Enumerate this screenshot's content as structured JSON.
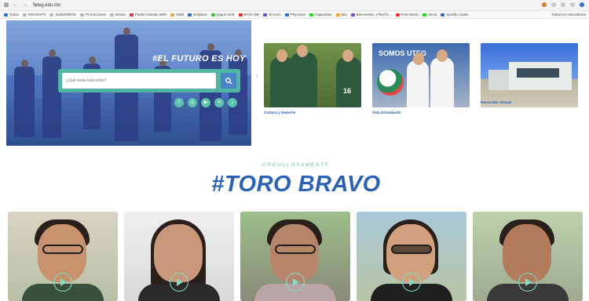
{
  "browser": {
    "url": "uteg.edu.mx",
    "bookmarks": [
      {
        "label": "Todas"
      },
      {
        "label": "MOOVAPS"
      },
      {
        "label": "SUBURBIOS"
      },
      {
        "label": "Promociones"
      },
      {
        "label": "Becas"
      },
      {
        "label": "Portal Cuentas Web"
      },
      {
        "label": "UNM"
      },
      {
        "label": "Empleos"
      },
      {
        "label": "pagos SGE"
      },
      {
        "label": "BAN LME"
      },
      {
        "label": "El Leon"
      },
      {
        "label": "Physician"
      },
      {
        "label": "Capacitate"
      },
      {
        "label": "Mia"
      },
      {
        "label": "Bienvenido, ¡Fleet le..."
      },
      {
        "label": "Free Music"
      },
      {
        "label": "Ateca"
      },
      {
        "label": "Spotify Codes"
      }
    ],
    "bookmarks_more": "Todos los marcadores"
  },
  "hero": {
    "tagline": "#EL FUTURO ES HOY",
    "search_placeholder": "¿Qué estás buscando?",
    "social_icons": [
      "facebook-icon",
      "instagram-icon",
      "youtube-icon",
      "x-icon",
      "tiktok-icon"
    ]
  },
  "carousel": {
    "cards": [
      {
        "label": "Cultura y Deporte",
        "jersey_numbers": [
          "16",
          "16"
        ]
      },
      {
        "label": "Vida Estudiantil",
        "banner_text": "SOMOS UTEG"
      },
      {
        "label": "Recorrido Virtual"
      }
    ]
  },
  "section": {
    "kicker": "ORGULLOSAMENTE",
    "title": "#TORO BRAVO"
  },
  "videos": [
    {
      "name": "video-1"
    },
    {
      "name": "video-2"
    },
    {
      "name": "video-3"
    },
    {
      "name": "video-4"
    },
    {
      "name": "video-5"
    }
  ],
  "colors": {
    "primary": "#2c62b3",
    "accent": "#5cbaa5",
    "hero_overlay": "#4c73bd"
  }
}
